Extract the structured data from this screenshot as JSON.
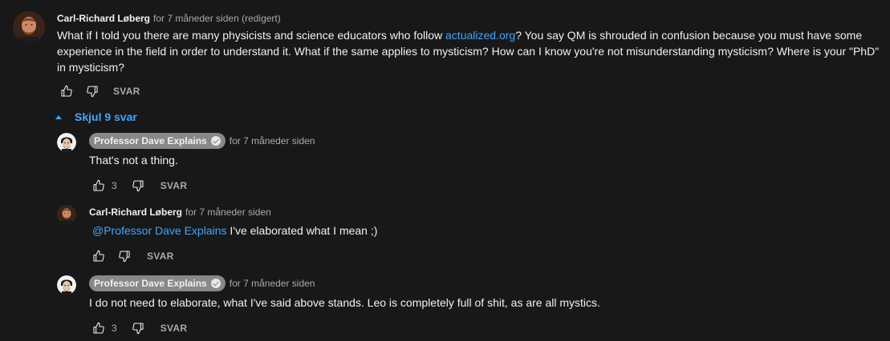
{
  "top_comment": {
    "author": "Carl-Richard Løberg",
    "time": "for 7 måneder siden (redigert)",
    "text_before_link": "What if I told you there are many physicists and science educators who follow ",
    "link_text": "actualized.org",
    "text_after_link": "? You say QM is shrouded in confusion because you must have some experience in the field in order to understand it. What if the same applies to mysticism? How can I know you're not misunderstanding mysticism? Where is your \"PhD\" in mysticism?",
    "reply_label": "SVAR"
  },
  "toggle_replies_label": "Skjul 9 svar",
  "replies": [
    {
      "author": "Professor Dave Explains",
      "verified": true,
      "time": "for 7 måneder siden",
      "text": "That's not a thing.",
      "likes": "3",
      "reply_label": "SVAR"
    },
    {
      "author": "Carl-Richard Løberg",
      "time": "for 7 måneder siden",
      "mention": "@Professor Dave Explains",
      "text": " I've elaborated what I mean ;)",
      "reply_label": "SVAR"
    },
    {
      "author": "Professor Dave Explains",
      "verified": true,
      "time": "for 7 måneder siden",
      "text": "I do not need to elaborate, what I've said above stands. Leo is completely full of shit, as are all mystics.",
      "likes": "3",
      "reply_label": "SVAR"
    }
  ],
  "colors": {
    "background": "#181818",
    "link": "#3ea6ff",
    "secondary_text": "#aaaaaa",
    "author_badge": "#888888"
  }
}
